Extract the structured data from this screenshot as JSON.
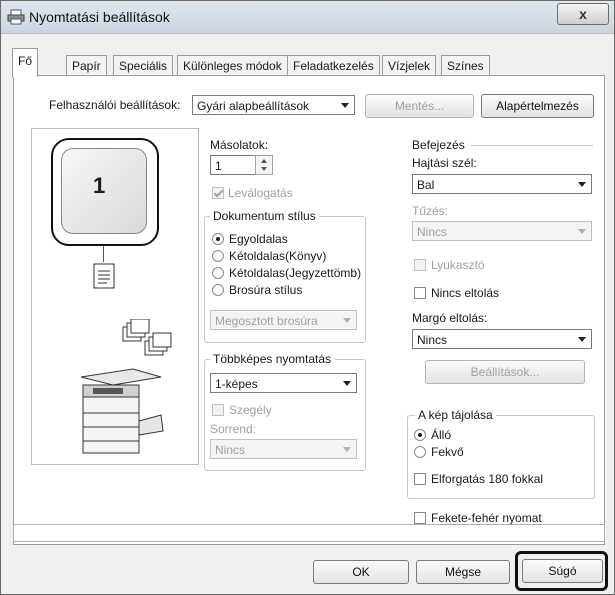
{
  "window": {
    "title": "Nyomtatási beállítások",
    "close_glyph": "x"
  },
  "tabs": [
    "Fő",
    "Papír",
    "Speciális",
    "Különleges módok",
    "Feladatkezelés",
    "Vízjelek",
    "Színes"
  ],
  "user_settings": {
    "label": "Felhasználói beállítások:",
    "value": "Gyári alapbeállítások",
    "save_label": "Mentés...",
    "defaults_label": "Alapértelmezés"
  },
  "preview": {
    "page_number": "1"
  },
  "copies": {
    "label": "Másolatok:",
    "value": "1",
    "collate_label": "Leválogatás"
  },
  "document_style": {
    "title": "Dokumentum stílus",
    "options": [
      "Egyoldalas",
      "Kétoldalas(Könyv)",
      "Kétoldalas(Jegyzettömb)",
      "Brosúra stílus"
    ],
    "selected": "Egyoldalas",
    "booklet_value": "Megosztott brosúra"
  },
  "nup": {
    "title": "Többképes nyomtatás",
    "value": "1-képes",
    "border_label": "Szegély",
    "order_label": "Sorrend:",
    "order_value": "Nincs"
  },
  "finishing": {
    "title": "Befejezés",
    "binding_edge_label": "Hajtási szél:",
    "binding_edge_value": "Bal",
    "staple_label": "Tűzés:",
    "staple_value": "Nincs",
    "punch_label": "Lyukasztó",
    "no_offset_label": "Nincs eltolás",
    "margin_shift_label": "Margó eltolás:",
    "margin_shift_value": "Nincs",
    "settings_label": "Beállítások..."
  },
  "orientation": {
    "title": "A kép tájolása",
    "options": [
      "Álló",
      "Fekvő"
    ],
    "selected": "Álló",
    "rotate_label": "Elforgatás 180 fokkal"
  },
  "bw_print_label": "Fekete-fehér nyomat",
  "footer": {
    "ok": "OK",
    "cancel": "Mégse",
    "help": "Súgó"
  }
}
